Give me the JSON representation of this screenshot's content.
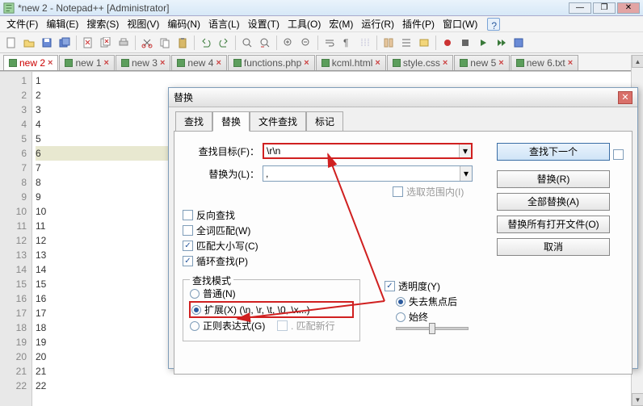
{
  "window_title": "*new 2 - Notepad++ [Administrator]",
  "menu": [
    "文件(F)",
    "编辑(E)",
    "搜索(S)",
    "视图(V)",
    "编码(N)",
    "语言(L)",
    "设置(T)",
    "工具(O)",
    "宏(M)",
    "运行(R)",
    "插件(P)",
    "窗口(W)",
    "?"
  ],
  "tabs": [
    {
      "label": "new 2",
      "active": true
    },
    {
      "label": "new 1",
      "active": false
    },
    {
      "label": "new 3",
      "active": false
    },
    {
      "label": "new 4",
      "active": false
    },
    {
      "label": "functions.php",
      "active": false
    },
    {
      "label": "kcml.html",
      "active": false
    },
    {
      "label": "style.css",
      "active": false
    },
    {
      "label": "new 5",
      "active": false
    },
    {
      "label": "new 6.txt",
      "active": false
    }
  ],
  "lines": [
    "1",
    "2",
    "3",
    "4",
    "5",
    "6",
    "7",
    "8",
    "9",
    "10",
    "11",
    "12",
    "13",
    "14",
    "15",
    "16",
    "17",
    "18",
    "19",
    "20",
    "21",
    "22"
  ],
  "current_line_index": 5,
  "dialog": {
    "title": "替换",
    "tabs": [
      {
        "label": "查找",
        "active": false
      },
      {
        "label": "替换",
        "active": true
      },
      {
        "label": "文件查找",
        "active": false
      },
      {
        "label": "标记",
        "active": false
      }
    ],
    "find_label": "查找目标(F)：",
    "find_value": "\\r\\n",
    "replace_label": "替换为(L)：",
    "replace_value": ",",
    "in_selection_label": "选取范围内(I)",
    "reverse_label": "反向查找",
    "whole_word_label": "全词匹配(W)",
    "match_case_label": "匹配大小写(C)",
    "wrap_label": "循环查找(P)",
    "mode_legend": "查找模式",
    "mode_normal": "普通(N)",
    "mode_extended": "扩展(X) (\\n, \\r, \\t, \\0, \\x...)",
    "mode_regex": "正则表达式(G)",
    "mode_regex_newline": ". 匹配新行",
    "transparency_label": "透明度(Y)",
    "on_lose_focus": "失去焦点后",
    "always": "始终",
    "buttons": {
      "find_next": "查找下一个",
      "replace": "替换(R)",
      "replace_all": "全部替换(A)",
      "replace_in_open": "替换所有打开文件(O)",
      "cancel": "取消"
    }
  }
}
